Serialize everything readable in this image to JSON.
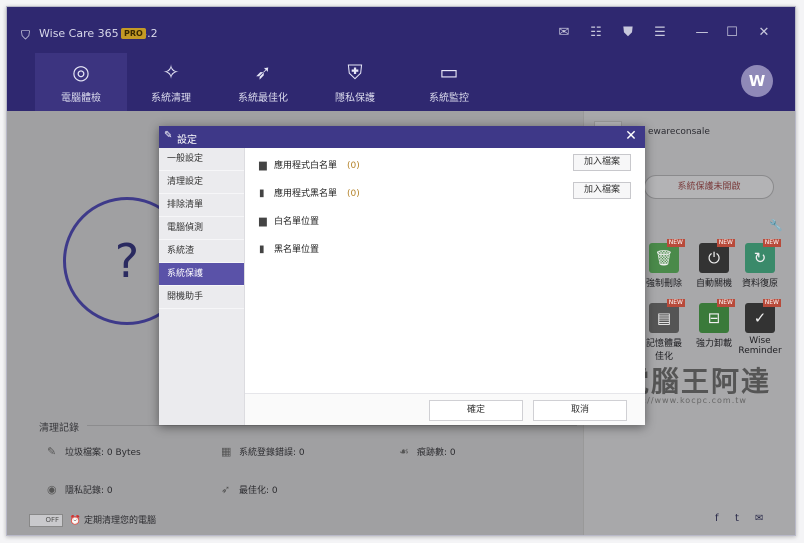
{
  "app": {
    "title": "Wise Care 365 - 5.3.2",
    "badge": "PRO",
    "user_initial": "W"
  },
  "nav": {
    "tabs": [
      {
        "label": "電腦體檢",
        "icon": "radar-icon"
      },
      {
        "label": "系統清理",
        "icon": "broom-icon"
      },
      {
        "label": "系統最佳化",
        "icon": "rocket-icon"
      },
      {
        "label": "隱私保護",
        "icon": "lock-shield-icon"
      },
      {
        "label": "系統監控",
        "icon": "monitor-pulse-icon"
      }
    ]
  },
  "background": {
    "account_name": "ewareconsale",
    "protect_status": "系統保護未開啟",
    "tools": [
      {
        "label": "強制刪除",
        "color": "#4a8a4a"
      },
      {
        "label": "自動關機",
        "color": "#333333"
      },
      {
        "label": "資料復原",
        "color": "#3a8a6a"
      },
      {
        "label": "記憶體最佳化",
        "color": "#555555"
      },
      {
        "label": "強力卸載",
        "color": "#3a7a3a"
      },
      {
        "label": "Wise Reminder",
        "color": "#333333"
      }
    ],
    "records_title": "清理記錄",
    "stats": [
      {
        "label": "垃圾檔案: 0 Bytes"
      },
      {
        "label": "系統登錄錯誤: 0"
      },
      {
        "label": "痕跡數: 0"
      },
      {
        "label": "隱私記錄: 0"
      },
      {
        "label": "最佳化: 0"
      }
    ],
    "toggle_state": "OFF",
    "schedule_text": "定期清理您的電腦",
    "watermark_text": "電腦王阿達",
    "watermark_url": "http://www.kocpc.com.tw",
    "accent_color": "#2f2870"
  },
  "dialog": {
    "title": "設定",
    "sidebar": [
      {
        "label": "一般設定"
      },
      {
        "label": "清理設定"
      },
      {
        "label": "排除清單"
      },
      {
        "label": "電腦偵測"
      },
      {
        "label": "系統渣"
      },
      {
        "label": "系統保護"
      },
      {
        "label": "開機助手"
      }
    ],
    "active_index": 5,
    "rows": [
      {
        "label": "應用程式白名單",
        "count": "(0)",
        "button": "加入檔案"
      },
      {
        "label": "應用程式黑名單",
        "count": "(0)",
        "button": "加入檔案"
      },
      {
        "label": "白名單位置"
      },
      {
        "label": "黑名單位置"
      }
    ],
    "ok_label": "確定",
    "cancel_label": "取消"
  }
}
